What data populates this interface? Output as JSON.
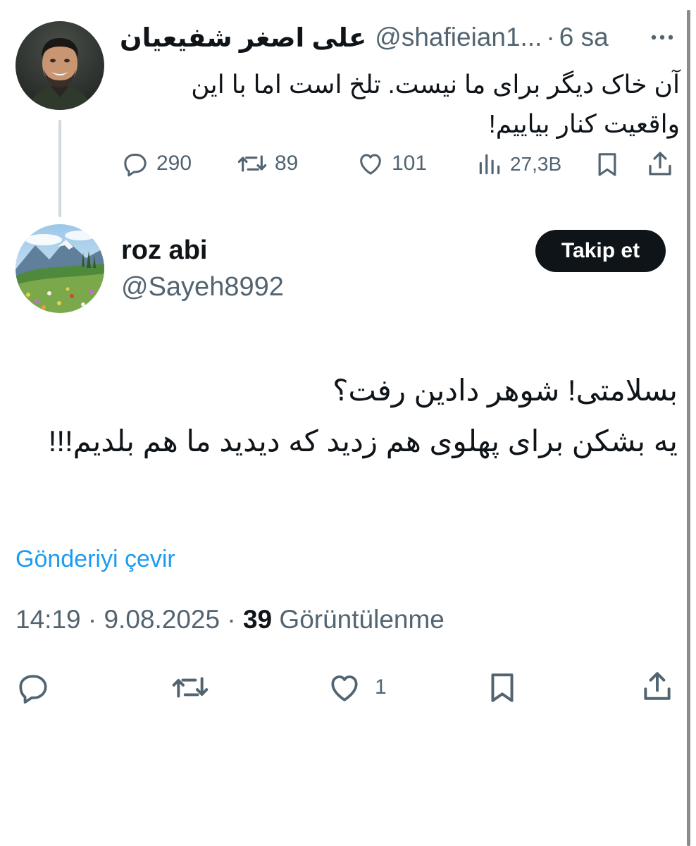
{
  "parent_tweet": {
    "author_name": "علی اصغر شفیعیان",
    "handle": "@shafieian1...",
    "separator": "·",
    "time": "6 sa",
    "text": "آن خاک دیگر برای ما نیست. تلخ است اما با این واقعیت کنار بیاییم!",
    "stats": {
      "replies": "290",
      "reposts": "89",
      "likes": "101",
      "views": "27,3B"
    }
  },
  "reply_tweet": {
    "author_name": "roz abi",
    "handle": "@Sayeh8992",
    "follow_label": "Takip et",
    "text_lines": [
      "بسلامتی! شوهر دادین رفت؟",
      "یه بشکن برای پهلوی هم زدید که دیدید ما هم بلدیم!!!"
    ],
    "translate_label": "Gönderiyi çevir",
    "time": "14:19",
    "date": "9.08.2025",
    "separator": "·",
    "views_count": "39",
    "views_label": "Görüntülenme",
    "likes": "1"
  },
  "icons": {
    "reply": "reply-icon",
    "repost": "repost-icon",
    "like": "heart-icon",
    "views": "analytics-icon",
    "bookmark": "bookmark-icon",
    "share": "share-icon",
    "more": "more-icon"
  },
  "colors": {
    "text_primary": "#0f1419",
    "text_secondary": "#536471",
    "link": "#1d9bf0",
    "follow_button_bg": "#0f1419",
    "thread_line": "#cfd9de"
  }
}
